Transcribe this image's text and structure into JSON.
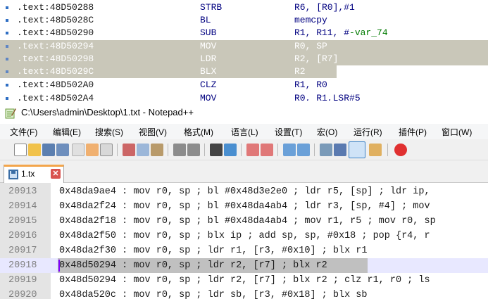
{
  "ida_listing": {
    "rows": [
      {
        "address": ".text:48D50288",
        "mnemonic": "STRB",
        "operands": "R6, [R0],#1",
        "var": ""
      },
      {
        "address": ".text:48D5028C",
        "mnemonic": "BL",
        "operands": "memcpy",
        "var": ""
      },
      {
        "address": ".text:48D50290",
        "mnemonic": "SUB",
        "operands": "R1, R11, #",
        "var": "-var_74"
      },
      {
        "address": ".text:48D50294",
        "mnemonic": "MOV",
        "operands": "R0, SP",
        "var": ""
      },
      {
        "address": ".text:48D50298",
        "mnemonic": "LDR",
        "operands": "R2, [R7]",
        "var": ""
      },
      {
        "address": ".text:48D5029C",
        "mnemonic": "BLX",
        "operands": "R2",
        "var": ""
      },
      {
        "address": ".text:48D502A0",
        "mnemonic": "CLZ",
        "operands": "R1, R0",
        "var": ""
      },
      {
        "address": ".text:48D502A4",
        "mnemonic": "MOV",
        "operands": "R0, R1,LSR#5",
        "var": ""
      }
    ]
  },
  "notepad": {
    "title": "C:\\Users\\admin\\Desktop\\1.txt - Notepad++",
    "menu": [
      "文件(F)",
      "编辑(E)",
      "搜索(S)",
      "视图(V)",
      "格式(M)",
      "语言(L)",
      "设置(T)",
      "宏(O)",
      "运行(R)",
      "插件(P)",
      "窗口(W)"
    ],
    "tab": {
      "label": "1.tx",
      "close_label": "✕"
    },
    "toolbar_icons": [
      "new-file-icon",
      "open-file-icon",
      "save-icon",
      "save-all-icon",
      "close-icon",
      "close-all-icon",
      "print-icon",
      "cut-icon",
      "copy-icon",
      "paste-icon",
      "undo-icon",
      "redo-icon",
      "find-icon",
      "replace-icon",
      "zoom-in-icon",
      "zoom-out-icon",
      "sync-vertical-icon",
      "sync-horizontal-icon",
      "word-wrap-icon",
      "show-all-chars-icon",
      "indent-guide-icon",
      "document-map-icon",
      "record-macro-icon"
    ],
    "lines": [
      {
        "number": "20913",
        "text": "0x48da9ae4 : mov r0, sp ; bl #0x48d3e2e0 ; ldr r5, [sp] ; ldr ip,"
      },
      {
        "number": "20914",
        "text": "0x48da2f24 : mov r0, sp ; bl #0x48da4ab4 ; ldr r3, [sp, #4] ; mov"
      },
      {
        "number": "20915",
        "text": "0x48da2f18 : mov r0, sp ; bl #0x48da4ab4 ; mov r1, r5 ; mov r0, sp"
      },
      {
        "number": "20916",
        "text": "0x48da2f50 : mov r0, sp ; blx ip ; add sp, sp, #0x18 ; pop {r4, r"
      },
      {
        "number": "20917",
        "text": "0x48da2f30 : mov r0, sp ; ldr r1, [r3, #0x10] ; blx r1"
      },
      {
        "number": "20918",
        "text": "0x48d50294 : mov r0, sp ; ldr r2, [r7] ; blx r2"
      },
      {
        "number": "20919",
        "text": "0x48d50294 : mov r0, sp ; ldr r2, [r7] ; blx r2 ; clz r1, r0 ; ls"
      },
      {
        "number": "20920",
        "text": "0x48da520c : mov r0, sp ; ldr sb, [r3, #0x18] ; blx sb"
      }
    ],
    "current_line": "20918"
  },
  "colors": {
    "ida_highlight": "#c9c7b9",
    "ida_operand": "#000080",
    "ida_var": "#007a00",
    "npp_tab_accent": "#f3a54b",
    "npp_selection": "#c0c0c0",
    "npp_caret": "#8000ff"
  }
}
